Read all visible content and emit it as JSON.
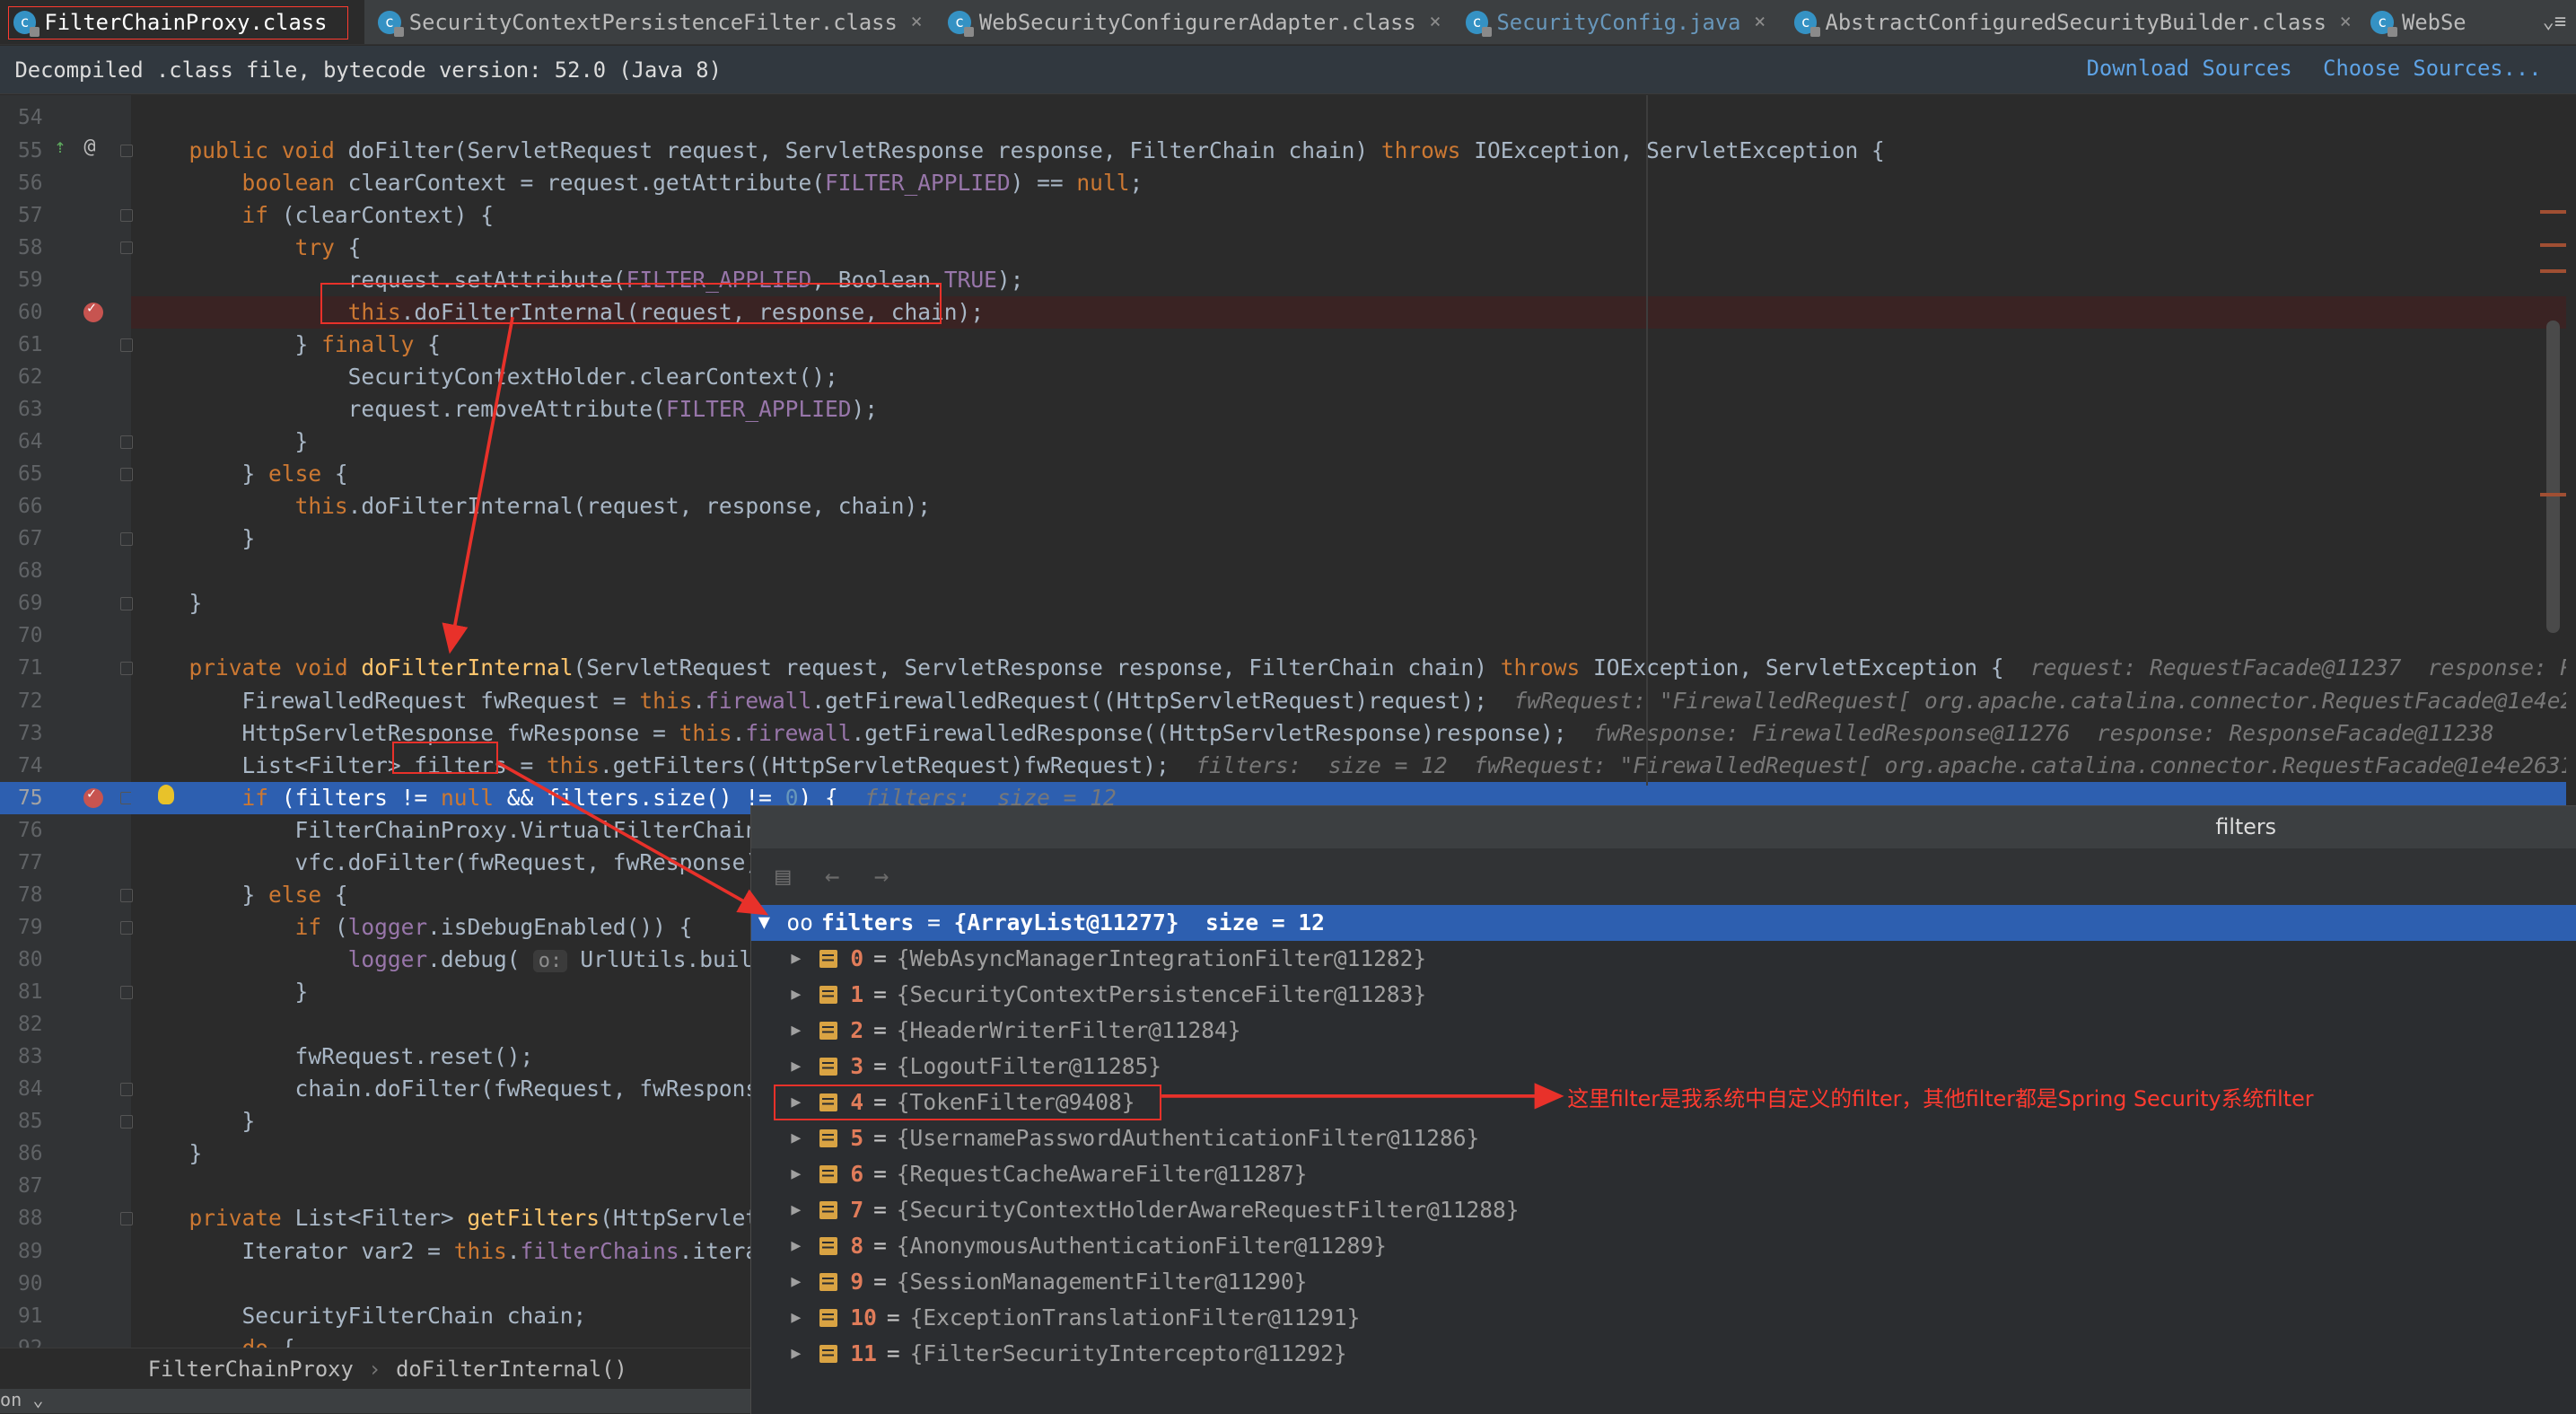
{
  "tabs": [
    {
      "label": "FilterChainProxy.class",
      "icon": "class-file-icon",
      "active": true
    },
    {
      "label": "SecurityContextPersistenceFilter.class",
      "icon": "class-file-icon"
    },
    {
      "label": "WebSecurityConfigurerAdapter.class",
      "icon": "class-file-icon"
    },
    {
      "label": "SecurityConfig.java",
      "icon": "java-class-icon"
    },
    {
      "label": "AbstractConfiguredSecurityBuilder.class",
      "icon": "class-file-icon"
    },
    {
      "label": "WebSe",
      "icon": "class-file-icon"
    }
  ],
  "tabs_more": "⌄≡",
  "banner": {
    "text": "Decompiled .class file, bytecode version: 52.0 (Java 8)",
    "download_sources": "Download Sources",
    "choose_sources": "Choose Sources..."
  },
  "line_numbers": [
    "54",
    "55",
    "56",
    "57",
    "58",
    "59",
    "60",
    "61",
    "62",
    "63",
    "64",
    "65",
    "66",
    "67",
    "68",
    "69",
    "70",
    "71",
    "72",
    "73",
    "74",
    "75",
    "76",
    "77",
    "78",
    "79",
    "80",
    "81",
    "82",
    "83",
    "84",
    "85",
    "86",
    "87",
    "88",
    "89",
    "90",
    "91",
    "92"
  ],
  "current_line": "75",
  "breadcrumb": {
    "class": "FilterChainProxy",
    "method": "doFilterInternal()"
  },
  "status": "on ⌄",
  "popup": {
    "title": "filters",
    "root": {
      "name": "filters",
      "value": "{ArrayList@11277}",
      "size": "size = 12"
    },
    "items": [
      {
        "index": "0",
        "value": "{WebAsyncManagerIntegrationFilter@11282}"
      },
      {
        "index": "1",
        "value": "{SecurityContextPersistenceFilter@11283}"
      },
      {
        "index": "2",
        "value": "{HeaderWriterFilter@11284}"
      },
      {
        "index": "3",
        "value": "{LogoutFilter@11285}"
      },
      {
        "index": "4",
        "value": "{TokenFilter@9408}"
      },
      {
        "index": "5",
        "value": "{UsernamePasswordAuthenticationFilter@11286}"
      },
      {
        "index": "6",
        "value": "{RequestCacheAwareFilter@11287}"
      },
      {
        "index": "7",
        "value": "{SecurityContextHolderAwareRequestFilter@11288}"
      },
      {
        "index": "8",
        "value": "{AnonymousAuthenticationFilter@11289}"
      },
      {
        "index": "9",
        "value": "{SessionManagementFilter@11290}"
      },
      {
        "index": "10",
        "value": "{ExceptionTranslationFilter@11291}"
      },
      {
        "index": "11",
        "value": "{FilterSecurityInterceptor@11292}"
      }
    ]
  },
  "annotation_note": "这里filter是我系统中自定义的filter，其他filter都是Spring Security系统filter",
  "colors": {
    "accent": "#2d5fb0",
    "annotation": "#e8312a",
    "keyword": "#cc7832",
    "field": "#9876aa"
  }
}
